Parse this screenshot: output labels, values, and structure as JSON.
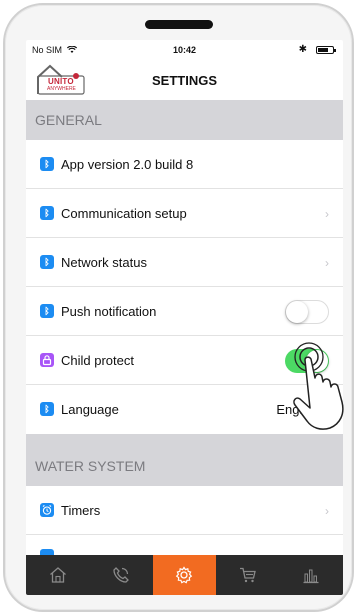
{
  "status_bar": {
    "carrier": "No SIM",
    "wifi_icon": "wifi-icon",
    "time": "10:42",
    "bluetooth_icon": "bluetooth-icon",
    "battery_icon": "battery-icon"
  },
  "header": {
    "title": "SETTINGS",
    "logo": {
      "brand": "UNITO",
      "tagline": "ANYWHERE"
    }
  },
  "sections": [
    {
      "title": "GENERAL"
    },
    {
      "title": "WATER SYSTEM"
    }
  ],
  "rows": {
    "app_version": {
      "label": "App version 2.0 build 8",
      "icon": "bluetooth-icon"
    },
    "communication": {
      "label": "Communication setup",
      "icon": "bluetooth-icon"
    },
    "network": {
      "label": "Network status",
      "icon": "bluetooth-icon"
    },
    "push": {
      "label": "Push notification",
      "icon": "bluetooth-icon",
      "enabled": false
    },
    "child": {
      "label": "Child protect",
      "icon": "lock-icon",
      "enabled": true
    },
    "language": {
      "label": "Language",
      "icon": "bluetooth-icon",
      "value": "English"
    },
    "timers": {
      "label": "Timers",
      "icon": "alarm-clock-icon"
    }
  },
  "tabbar": {
    "items": [
      {
        "name": "home",
        "icon": "home-icon"
      },
      {
        "name": "support",
        "icon": "phone-icon"
      },
      {
        "name": "settings",
        "icon": "gear-icon",
        "active": true
      },
      {
        "name": "cart",
        "icon": "cart-icon"
      },
      {
        "name": "statistics",
        "icon": "bar-chart-icon"
      }
    ]
  },
  "colors": {
    "accent_blue": "#1c8cf2",
    "toggle_on": "#4cd964",
    "child_icon": "#a855f7",
    "tab_active": "#f26b21",
    "section_bg": "#d5d5d9",
    "tabbar_bg": "#2b2b2b"
  }
}
